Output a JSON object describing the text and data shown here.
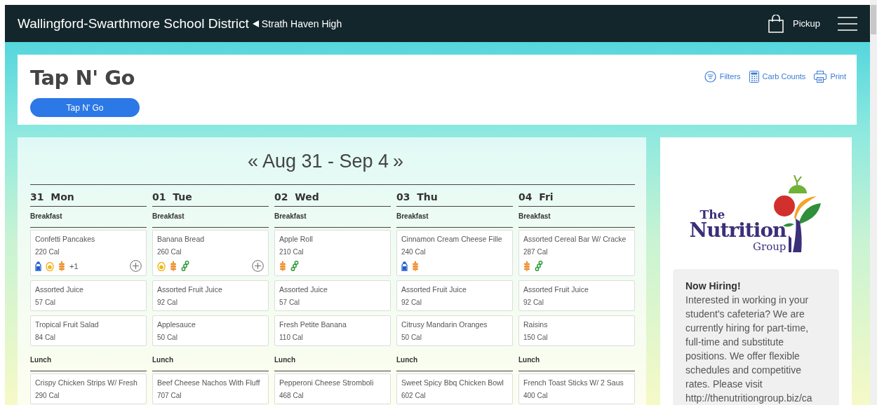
{
  "top_bar": {
    "district": "Wallingford-Swarthmore School District",
    "school": "Strath Haven High",
    "pickup": "Pickup"
  },
  "header": {
    "title": "Tap N' Go",
    "menu_button": "Tap N' Go",
    "actions": [
      {
        "kind": "filters",
        "label": "Filters"
      },
      {
        "kind": "carb",
        "label": "Carb Counts"
      },
      {
        "kind": "print",
        "label": "Print"
      }
    ]
  },
  "week": {
    "prev": "«",
    "range": "Aug 31 - Sep 4",
    "next": "»"
  },
  "days": [
    {
      "number": "31",
      "name": "Mon",
      "meals": [
        {
          "name": "Breakfast",
          "items": [
            {
              "name": "Confetti Pancakes",
              "calories": "220 Cal",
              "allergens": [
                {
                  "kind": "milk"
                },
                {
                  "kind": "egg"
                },
                {
                  "kind": "wheat"
                }
              ],
              "more": "+1",
              "add_button": true
            },
            {
              "name": "Assorted Juice",
              "calories": "57 Cal"
            },
            {
              "name": "Tropical Fruit Salad",
              "calories": "84 Cal"
            }
          ]
        },
        {
          "name": "Lunch",
          "items": [
            {
              "name": "Crispy Chicken Strips W/ Fresh",
              "calories": "290 Cal"
            }
          ]
        }
      ]
    },
    {
      "number": "01",
      "name": "Tue",
      "meals": [
        {
          "name": "Breakfast",
          "items": [
            {
              "name": "Banana Bread",
              "calories": "260 Cal",
              "allergens": [
                {
                  "kind": "egg"
                },
                {
                  "kind": "wheat"
                },
                {
                  "kind": "soy"
                }
              ],
              "add_button": true
            },
            {
              "name": "Assorted Fruit Juice",
              "calories": "92 Cal"
            },
            {
              "name": "Applesauce",
              "calories": "50 Cal"
            }
          ]
        },
        {
          "name": "Lunch",
          "items": [
            {
              "name": "Beef Cheese Nachos With Fluff",
              "calories": "707 Cal"
            }
          ]
        }
      ]
    },
    {
      "number": "02",
      "name": "Wed",
      "meals": [
        {
          "name": "Breakfast",
          "items": [
            {
              "name": "Apple Roll",
              "calories": "210 Cal",
              "allergens": [
                {
                  "kind": "wheat"
                },
                {
                  "kind": "soy"
                }
              ],
              "add_button": false
            },
            {
              "name": "Assorted Juice",
              "calories": "57 Cal"
            },
            {
              "name": "Fresh Petite Banana",
              "calories": "110 Cal"
            }
          ]
        },
        {
          "name": "Lunch",
          "items": [
            {
              "name": "Pepperoni Cheese Stromboli",
              "calories": "468 Cal"
            }
          ]
        }
      ]
    },
    {
      "number": "03",
      "name": "Thu",
      "meals": [
        {
          "name": "Breakfast",
          "items": [
            {
              "name": "Cinnamon Cream Cheese Fille",
              "calories": "240 Cal",
              "allergens": [
                {
                  "kind": "milk"
                },
                {
                  "kind": "wheat"
                }
              ],
              "add_button": false
            },
            {
              "name": "Assorted Fruit Juice",
              "calories": "92 Cal"
            },
            {
              "name": "Citrusy Mandarin Oranges",
              "calories": "50 Cal"
            }
          ]
        },
        {
          "name": "Lunch",
          "items": [
            {
              "name": "Sweet Spicy Bbq Chicken Bowl",
              "calories": "602 Cal"
            }
          ]
        }
      ]
    },
    {
      "number": "04",
      "name": "Fri",
      "meals": [
        {
          "name": "Breakfast",
          "items": [
            {
              "name": "Assorted Cereal Bar W/ Cracke",
              "calories": "287 Cal",
              "allergens": [
                {
                  "kind": "wheat"
                },
                {
                  "kind": "soy"
                }
              ],
              "add_button": false
            },
            {
              "name": "Assorted Fruit Juice",
              "calories": "92 Cal"
            },
            {
              "name": "Raisins",
              "calories": "150 Cal"
            }
          ]
        },
        {
          "name": "Lunch",
          "items": [
            {
              "name": "French Toast Sticks W/ 2 Saus",
              "calories": "400 Cal"
            }
          ]
        }
      ]
    }
  ],
  "sidebar": {
    "logo": {
      "line_1": "The",
      "line_2": "Nutrition",
      "line_3": "Group"
    },
    "notice": {
      "title": "Now Hiring!",
      "body": "Interested in working in your student's cafeteria? We are currently hiring for part-time, full-time and substitute positions. We offer flexible schedules and competitive rates. Please visit http://thenutritiongroup.biz/ca"
    }
  }
}
